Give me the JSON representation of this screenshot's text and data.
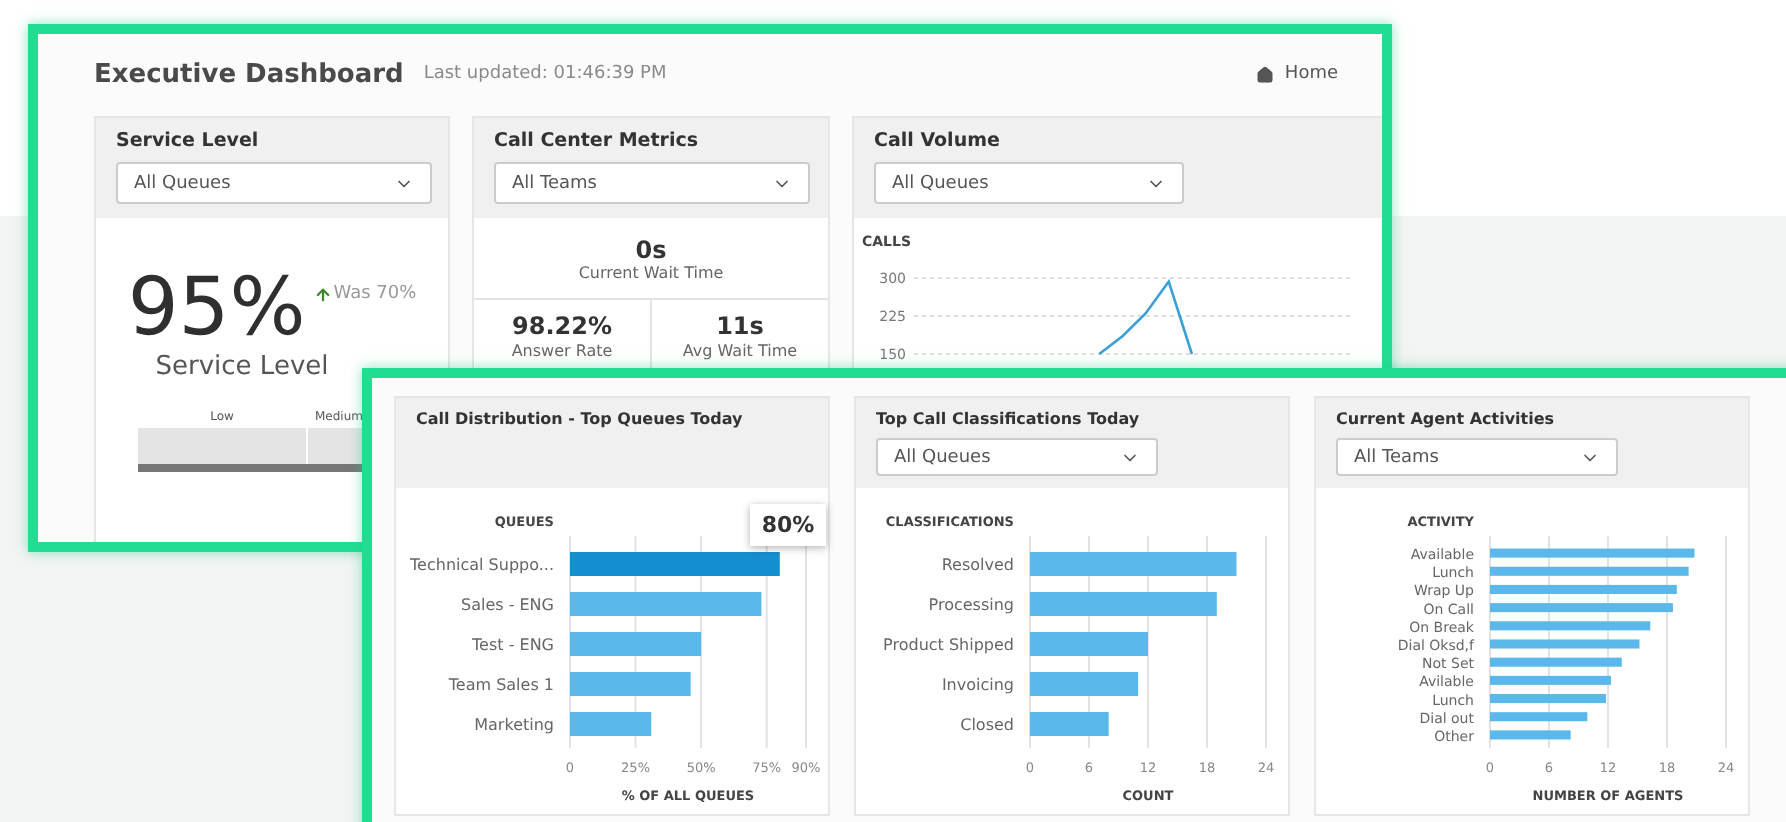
{
  "back_window": {
    "title": "Executive Dashboard",
    "last_updated": "Last updated: 01:46:39 PM",
    "home_link": "Home",
    "service_level": {
      "title": "Service Level",
      "filter": "All Queues",
      "value": "95%",
      "trend": "Was 70%",
      "label": "Service Level",
      "gauge_labels": [
        "Low",
        "Medium"
      ]
    },
    "call_center_metrics": {
      "title": "Call Center Metrics",
      "filter": "All Teams",
      "metrics": [
        {
          "value": "0s",
          "label": "Current Wait Time"
        },
        {
          "value": "98.22%",
          "label": "Answer Rate"
        },
        {
          "value": "11s",
          "label": "Avg Wait Time"
        }
      ]
    },
    "call_volume": {
      "title": "Call Volume",
      "filter": "All Queues",
      "chart_data": {
        "type": "line",
        "ylabel": "CALLS",
        "ylim": [
          150,
          300
        ],
        "yticks": [
          150,
          225,
          300
        ],
        "grid": true,
        "series": [
          {
            "color": "#3a9fd6",
            "values": [
              null,
              null,
              null,
              null,
              null,
              null,
              null,
              null,
              150,
              185,
              230,
              293,
              150,
              null,
              null,
              null,
              null,
              null,
              null,
              null
            ]
          }
        ]
      }
    }
  },
  "front_window": {
    "cards": [
      {
        "title": "Call Distribution - Top Queues Today",
        "tooltip": "80%",
        "bar_states": [
          {
            "selected": true
          },
          {
            "selected": false
          },
          {
            "selected": false
          },
          {
            "selected": false
          },
          {
            "selected": false
          }
        ],
        "chart_data": {
          "type": "bar",
          "orientation": "horizontal",
          "grid": true,
          "ylabel": "QUEUES",
          "xlabel": "% OF ALL QUEUES",
          "categories": [
            "Technical Suppo...",
            "Sales - ENG",
            "Test - ENG",
            "Team Sales 1",
            "Marketing"
          ],
          "xlim": [
            0,
            90
          ],
          "xticks": [
            {
              "value": 0,
              "label": "0"
            },
            {
              "value": 25,
              "label": "25%"
            },
            {
              "value": 50,
              "label": "50%"
            },
            {
              "value": 75,
              "label": "75%"
            },
            {
              "value": 90,
              "label": "90%"
            }
          ],
          "series": [
            {
              "color": "#5bb8ea",
              "values": [
                80,
                73,
                50,
                46,
                31
              ]
            }
          ]
        }
      },
      {
        "title": "Top Call Classifications Today",
        "filter": "All Queues",
        "chart_data": {
          "type": "bar",
          "orientation": "horizontal",
          "grid": true,
          "ylabel": "CLASSIFICATIONS",
          "xlabel": "COUNT",
          "categories": [
            "Resolved",
            "Processing",
            "Product Shipped",
            "Invoicing",
            "Closed"
          ],
          "xlim": [
            0,
            24
          ],
          "xticks": [
            0,
            6,
            12,
            18,
            24
          ],
          "series": [
            {
              "color": "#5bb8ea",
              "values": [
                21,
                19,
                12,
                11,
                8
              ]
            }
          ]
        }
      },
      {
        "title": "Current Agent Activities",
        "filter": "All Teams",
        "chart_data": {
          "type": "bar",
          "orientation": "horizontal",
          "grid": true,
          "ylabel": "ACTIVITY",
          "xlabel": "NUMBER OF AGENTS",
          "categories": [
            "Available",
            "Lunch",
            "Wrap Up",
            "On Call",
            "On Break",
            "Dial Oksd,f",
            "Not Set",
            "Avilable",
            "Lunch",
            "Dial out",
            "Other"
          ],
          "xlim": [
            0,
            24
          ],
          "xticks": [
            0,
            6,
            12,
            18,
            24
          ],
          "series": [
            {
              "color": "#5bb8ea",
              "values": [
                20.8,
                20.2,
                19,
                18.6,
                16.3,
                15.2,
                13.4,
                12.3,
                11.8,
                9.9,
                8.2
              ]
            }
          ]
        }
      }
    ]
  }
}
